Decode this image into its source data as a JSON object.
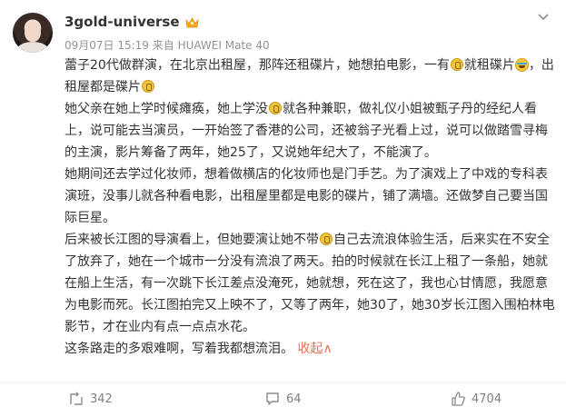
{
  "post": {
    "username": "3gold-universe",
    "meta": "09月07日 15:19  来自 HUAWEI Mate 40",
    "paragraphs": {
      "p1_a": "蕾子20代做群演，在北京出租屋，那阵还租碟片，她想拍电影，一有",
      "p1_b": "就租碟片",
      "p1_c": "，出租屋都是碟片",
      "p2_a": "她父亲在她上学时候瘫痪，她上学没",
      "p2_b": "就各种兼职，做礼仪小姐被甄子丹的经纪人看上，说可能去当演员，一开始签了香港的公司，还被翁子光看上过，说可以做踏雪寻梅的主演，影片筹备了两年，她25了，又说她年纪大了，不能演了。",
      "p3": "她期间还去学过化妆师，想着做横店的化妆师也是门手艺。为了演戏上了中戏的专科表演班，没事儿就各种看电影，出租屋里都是电影的碟片，铺了满墙。还做梦自己要当国际巨星。",
      "p4_a": "后来被长江图的导演看上，但她要演让她不带",
      "p4_b": "自己去流浪体验生活，后来实在不安全了放弃了，她在一个城市一分没有流浪了两天。拍的时候就在长江上租了一条船，她就在船上生活，有一次跳下长江差点没淹死，她就想，死在这了，我也心甘情愿，我愿意为电影而死。长江图拍完又上映不了，又等了两年，她30了，她30岁长江图入围柏林电影节，才在业内有点一点点水花。",
      "p5": "这条路走的多艰难啊，写着我都想流泪。",
      "collapse": "收起∧"
    }
  },
  "actions": {
    "repost_count": "342",
    "comment_count": "64",
    "like_count": "4704"
  },
  "colors": {
    "link": "#eb7350",
    "meta": "#939393"
  },
  "icons": [
    "crown-badge-icon",
    "more-menu-icon",
    "coin-emoji-icon",
    "laugh-cry-emoji-icon",
    "repost-icon",
    "comment-icon",
    "like-icon"
  ]
}
